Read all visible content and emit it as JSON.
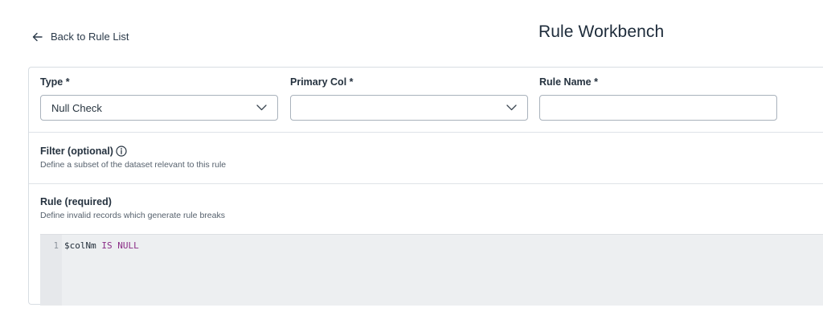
{
  "header": {
    "back_label": "Back to Rule List",
    "title": "Rule Workbench"
  },
  "form": {
    "type": {
      "label": "Type",
      "required_mark": "*",
      "value": "Null Check"
    },
    "primary_col": {
      "label": "Primary Col",
      "required_mark": "*",
      "value": ""
    },
    "rule_name": {
      "label": "Rule Name",
      "required_mark": "*",
      "value": ""
    }
  },
  "filter": {
    "title": "Filter (optional)",
    "description": "Define a subset of the dataset relevant to this rule"
  },
  "rule": {
    "title": "Rule (required)",
    "description": "Define invalid records which generate rule breaks",
    "editor": {
      "line_number": "1",
      "code_identifier": "$colNm",
      "code_keywords": "IS NULL"
    }
  },
  "colors": {
    "keyword": "#8a2c86",
    "editor_bg": "#edeff1",
    "border": "#a9b2bc"
  },
  "icons": {
    "back": "arrow-left-icon",
    "dropdown": "chevron-down-icon",
    "info": "info-circle-icon"
  }
}
